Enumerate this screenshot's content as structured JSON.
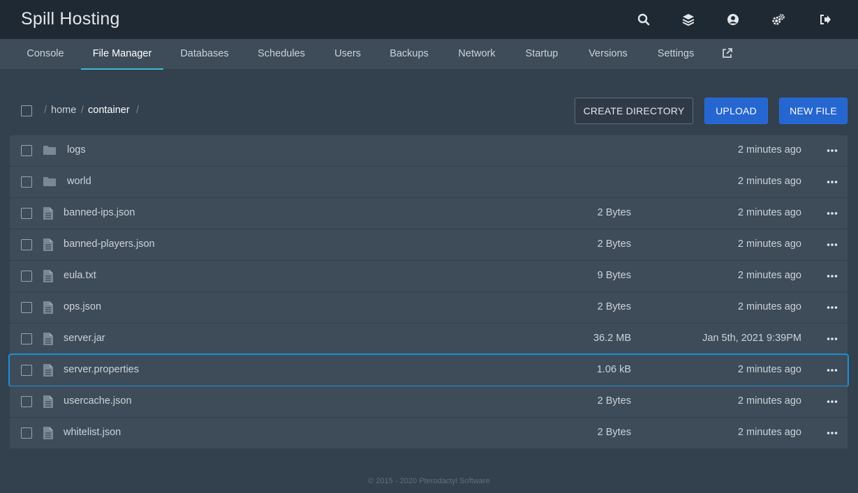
{
  "app": {
    "title": "Spill Hosting"
  },
  "topbar_icons": [
    "search-icon",
    "layers-icon",
    "user-icon",
    "settings-icon",
    "logout-icon"
  ],
  "nav": {
    "tabs": [
      {
        "label": "Console"
      },
      {
        "label": "File Manager",
        "active": true
      },
      {
        "label": "Databases"
      },
      {
        "label": "Schedules"
      },
      {
        "label": "Users"
      },
      {
        "label": "Backups"
      },
      {
        "label": "Network"
      },
      {
        "label": "Startup"
      },
      {
        "label": "Versions"
      },
      {
        "label": "Settings"
      }
    ],
    "external_icon": "external-link-icon"
  },
  "breadcrumb": {
    "separator": "/",
    "segments": [
      "home",
      "container"
    ]
  },
  "actions": {
    "create_directory": "CREATE DIRECTORY",
    "upload": "UPLOAD",
    "new_file": "NEW FILE"
  },
  "files": [
    {
      "name": "logs",
      "type": "folder",
      "size": "",
      "modified": "2 minutes ago"
    },
    {
      "name": "world",
      "type": "folder",
      "size": "",
      "modified": "2 minutes ago"
    },
    {
      "name": "banned-ips.json",
      "type": "file",
      "size": "2 Bytes",
      "modified": "2 minutes ago"
    },
    {
      "name": "banned-players.json",
      "type": "file",
      "size": "2 Bytes",
      "modified": "2 minutes ago"
    },
    {
      "name": "eula.txt",
      "type": "file",
      "size": "9 Bytes",
      "modified": "2 minutes ago"
    },
    {
      "name": "ops.json",
      "type": "file",
      "size": "2 Bytes",
      "modified": "2 minutes ago"
    },
    {
      "name": "server.jar",
      "type": "file",
      "size": "36.2 MB",
      "modified": "Jan 5th, 2021 9:39PM"
    },
    {
      "name": "server.properties",
      "type": "file",
      "size": "1.06 kB",
      "modified": "2 minutes ago",
      "highlighted": true
    },
    {
      "name": "usercache.json",
      "type": "file",
      "size": "2 Bytes",
      "modified": "2 minutes ago"
    },
    {
      "name": "whitelist.json",
      "type": "file",
      "size": "2 Bytes",
      "modified": "2 minutes ago"
    }
  ],
  "footer": {
    "text": "© 2015 - 2020 Pterodactyl Software"
  },
  "colors": {
    "topbar": "#1f2933",
    "tabbar": "#3e4c59",
    "background": "#33404d",
    "accent": "#3ebcd3",
    "primary_button": "#2566d0",
    "highlight_outline": "#1c8fd4"
  }
}
